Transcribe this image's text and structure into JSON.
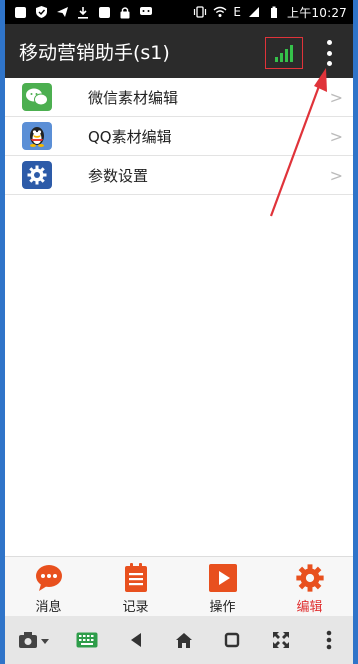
{
  "status_bar": {
    "battery_text": "E",
    "time": "上午10:27"
  },
  "app": {
    "title": "移动营销助手(s1)"
  },
  "menu": [
    {
      "label": "微信素材编辑",
      "chevron": ">",
      "icon": "wechat-icon",
      "color": "#4caf50"
    },
    {
      "label": "QQ素材编辑",
      "chevron": ">",
      "icon": "qq-penguin-icon",
      "color": "#5b8fd6"
    },
    {
      "label": "参数设置",
      "chevron": ">",
      "icon": "gear-icon",
      "color": "#2d5ba8"
    }
  ],
  "bottom_nav": [
    {
      "label": "消息",
      "icon": "message-icon",
      "active": false
    },
    {
      "label": "记录",
      "icon": "list-icon",
      "active": false
    },
    {
      "label": "操作",
      "icon": "play-icon",
      "active": false
    },
    {
      "label": "编辑",
      "icon": "gear-icon",
      "active": true
    }
  ],
  "colors": {
    "appbar": "#2b2b2b",
    "accent": "#e8501e",
    "active_label": "#e03030",
    "signal": "#35c24a",
    "annotation": "#e0333a"
  }
}
